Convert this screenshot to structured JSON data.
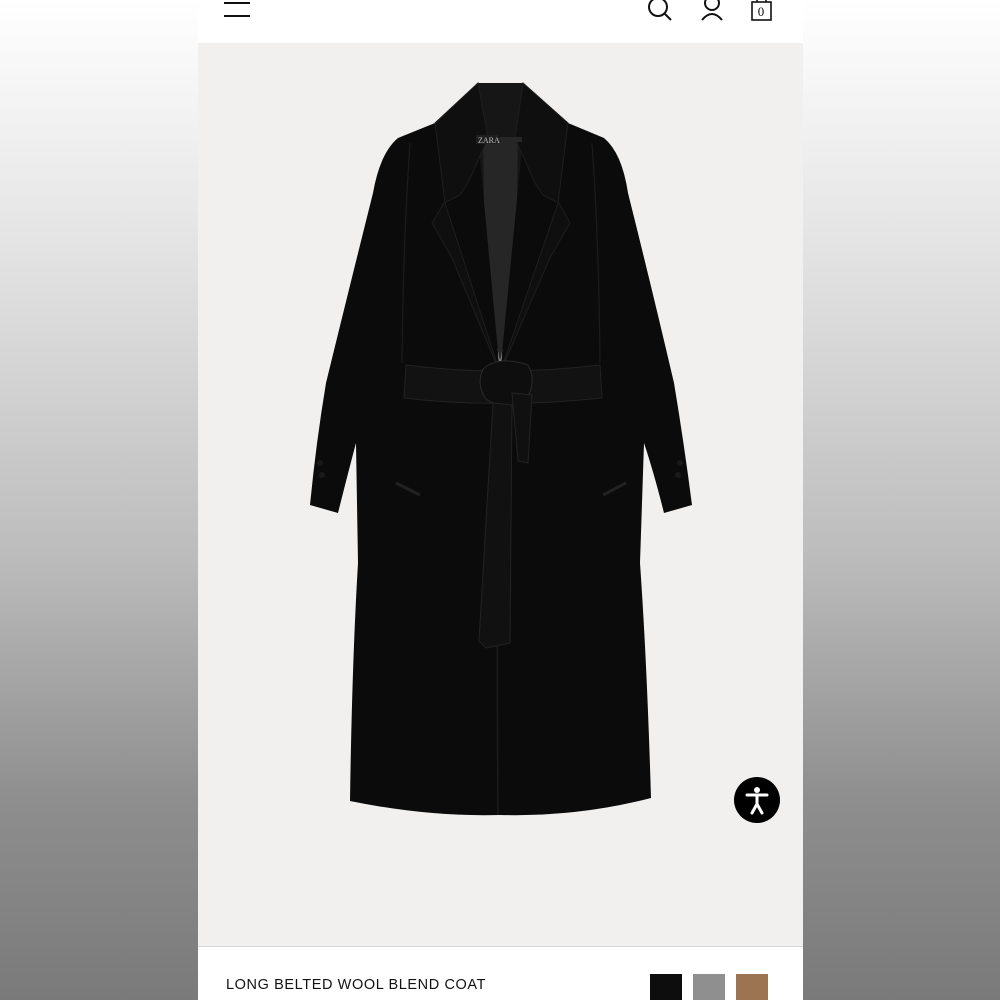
{
  "header": {
    "icons": [
      "menu-icon",
      "search-icon",
      "user-icon",
      "shopping-bag-icon"
    ],
    "cart_count": "0"
  },
  "product": {
    "name": "LONG BELTED WOOL BLEND COAT",
    "label_brand": "ZARA",
    "colors": [
      {
        "name": "black",
        "hex": "#0d0d0d"
      },
      {
        "name": "grey",
        "hex": "#8f8f8f"
      },
      {
        "name": "camel",
        "hex": "#9c7452"
      }
    ]
  },
  "accessibility": {
    "icon": "accessibility-icon"
  },
  "theme": {
    "image_bg": "#f1f0ef",
    "coat": "#0b0b0b",
    "text": "#111111"
  }
}
